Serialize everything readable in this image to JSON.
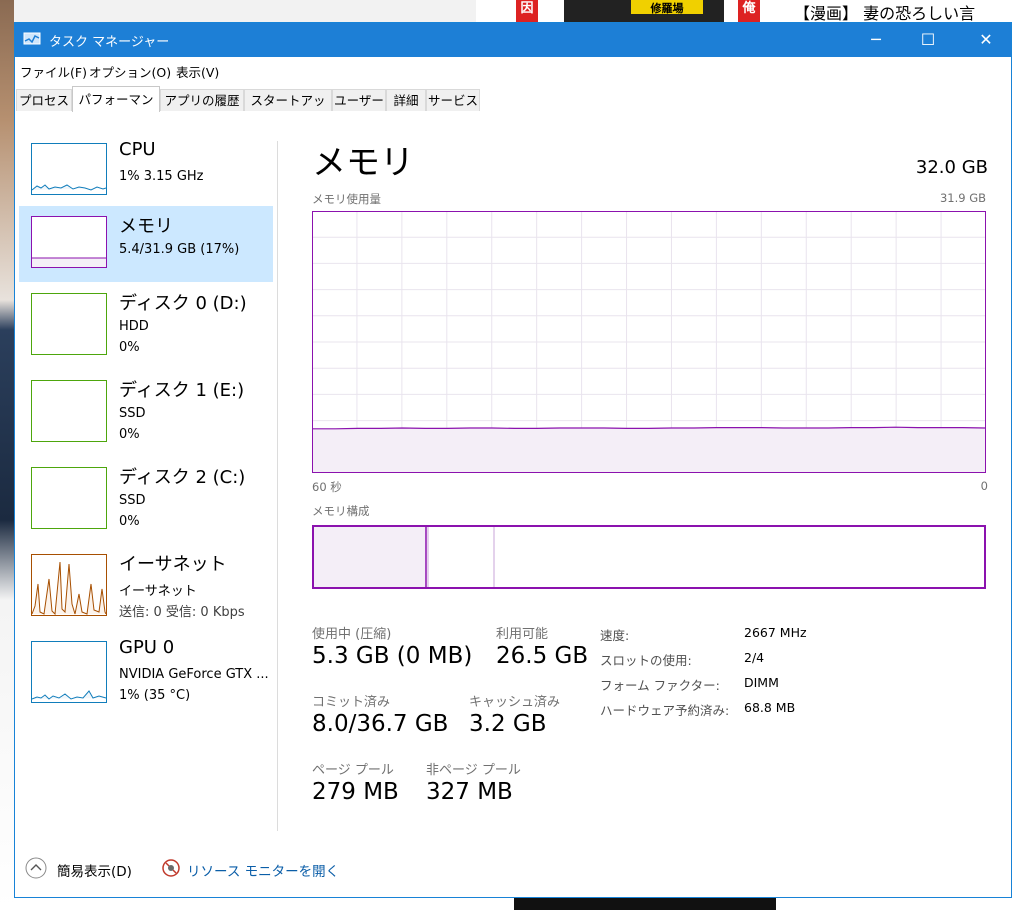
{
  "window": {
    "title": "タスク マネージャー",
    "controls": {
      "minimize": "─",
      "maximize": "☐",
      "close": "✕"
    }
  },
  "menu": [
    "ファイル(F)",
    "オプション(O)",
    "表示(V)"
  ],
  "tabs": [
    "プロセス",
    "パフォーマンス",
    "アプリの履歴",
    "スタートアップ",
    "ユーザー",
    "詳細",
    "サービス"
  ],
  "active_tab": "パフォーマンス",
  "sidebar": [
    {
      "title": "CPU",
      "line2": "1%  3.15 GHz",
      "line3": ""
    },
    {
      "title": "メモリ",
      "line2": "5.4/31.9 GB (17%)",
      "line3": ""
    },
    {
      "title": "ディスク 0 (D:)",
      "line2": "HDD",
      "line3": "0%"
    },
    {
      "title": "ディスク 1 (E:)",
      "line2": "SSD",
      "line3": "0%"
    },
    {
      "title": "ディスク 2 (C:)",
      "line2": "SSD",
      "line3": "0%"
    },
    {
      "title": "イーサネット",
      "line2": "イーサネット",
      "line3": "送信: 0 受信: 0 Kbps"
    },
    {
      "title": "GPU 0",
      "line2": "NVIDIA GeForce GTX ...",
      "line3": "1%  (35 °C)"
    }
  ],
  "selected_item": "メモリ",
  "main": {
    "title": "メモリ",
    "total": "32.0 GB",
    "usage_label": "メモリ使用量",
    "usage_max": "31.9 GB",
    "axis_left": "60 秒",
    "axis_right": "0",
    "composition_label": "メモリ構成",
    "stats": {
      "in_use_label": "使用中 (圧縮)",
      "in_use_value": "5.3 GB (0 MB)",
      "available_label": "利用可能",
      "available_value": "26.5 GB",
      "committed_label": "コミット済み",
      "committed_value": "8.0/36.7 GB",
      "cached_label": "キャッシュ済み",
      "cached_value": "3.2 GB",
      "paged_label": "ページ プール",
      "paged_value": "279 MB",
      "nonpaged_label": "非ページ プール",
      "nonpaged_value": "327 MB"
    },
    "details": {
      "speed_label": "速度:",
      "speed_value": "2667 MHz",
      "slots_label": "スロットの使用:",
      "slots_value": "2/4",
      "form_label": "フォーム ファクター:",
      "form_value": "DIMM",
      "reserved_label": "ハードウェア予約済み:",
      "reserved_value": "68.8 MB"
    }
  },
  "footer": {
    "fewer_details": "簡易表示(D)",
    "resource_monitor": "リソース モニターを開く"
  },
  "background": {
    "tag_red": "因",
    "tag_yellow": "修羅場",
    "tag_red2": "俺",
    "headline": "【漫画】 妻の恐ろしい言"
  },
  "chart_data": {
    "type": "area",
    "title": "メモリ使用量",
    "xlabel": "60 秒",
    "ylim": [
      0,
      31.9
    ],
    "unit": "GB",
    "series": [
      {
        "values": [
          5.3,
          5.3,
          5.35,
          5.35,
          5.4,
          5.35,
          5.35,
          5.4,
          5.4,
          5.35,
          5.35,
          5.4,
          5.4,
          5.4,
          5.35,
          5.35,
          5.4,
          5.4,
          5.45,
          5.45,
          5.45,
          5.4,
          5.4,
          5.4,
          5.45,
          5.45,
          5.5,
          5.45,
          5.45,
          5.45,
          5.4
        ]
      }
    ]
  },
  "colors": {
    "titlebar": "#1d7fd6",
    "memory": "#8b12ae",
    "cpu": "#117dbb",
    "disk": "#4da60c",
    "ethernet": "#a74f01",
    "selected": "#cce8ff"
  }
}
